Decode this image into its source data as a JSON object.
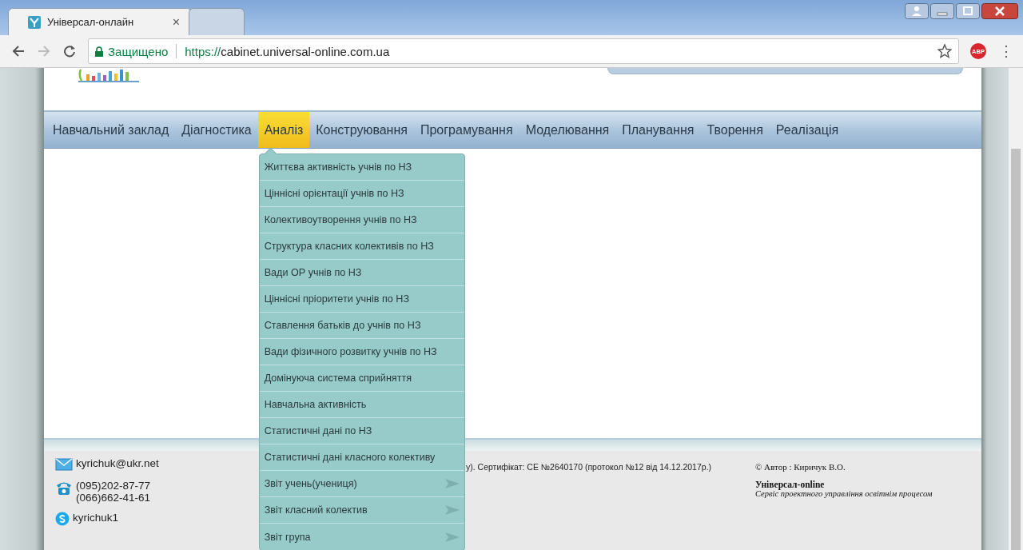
{
  "browser": {
    "tabs": [
      {
        "title": "Універсал-онлайн",
        "close": "×",
        "selected": true
      },
      {
        "selected": false
      }
    ],
    "security_label": "Защищено",
    "url_scheme": "https://",
    "url_host": "cabinet.universal-online.com.ua",
    "extension_label": "ABP",
    "menu_glyph": "⋮"
  },
  "nav": {
    "items": [
      {
        "label": "Навчальний заклад",
        "selected": false
      },
      {
        "label": "Діагностика",
        "selected": false
      },
      {
        "label": "Аналіз",
        "selected": true
      },
      {
        "label": "Конструювання",
        "selected": false
      },
      {
        "label": "Програмування",
        "selected": false
      },
      {
        "label": "Моделювання",
        "selected": false
      },
      {
        "label": "Планування",
        "selected": false
      },
      {
        "label": "Творення",
        "selected": false
      },
      {
        "label": "Реалізація",
        "selected": false
      }
    ]
  },
  "dropdown": {
    "items": [
      {
        "label": "Життєва активність учнів по НЗ",
        "kind": "item"
      },
      {
        "label": "Ціннісні орієнтації учнів по НЗ",
        "kind": "item"
      },
      {
        "label": "Колективоутворення учнів по НЗ",
        "kind": "item"
      },
      {
        "label": "Структура класних колективів по НЗ",
        "kind": "item"
      },
      {
        "label": "Вади ОР учнів по НЗ",
        "kind": "item"
      },
      {
        "label": "Ціннісні пріоритети учнів по НЗ",
        "kind": "item"
      },
      {
        "label": "Ставлення батьків до учнів по НЗ",
        "kind": "item"
      },
      {
        "label": "Вади фізичного розвитку учнів по НЗ",
        "kind": "item"
      },
      {
        "label": "Домінуюча система сприйняття",
        "kind": "item"
      },
      {
        "label": "Навчальна активність",
        "kind": "item"
      },
      {
        "label": "Статистичні дані по НЗ",
        "kind": "item"
      },
      {
        "label": "Статистичні дані класного колективу",
        "kind": "item"
      },
      {
        "label": "Звіт учень(учениця)",
        "kind": "submenu"
      },
      {
        "label": "Звіт класний колектив",
        "kind": "submenu"
      },
      {
        "label": "Звіт група",
        "kind": "submenu"
      }
    ]
  },
  "footer": {
    "email": "kyrichuk@ukr.net",
    "phones": [
      "(095)202-87-77",
      "(066)662-41-61"
    ],
    "skype": "kyrichuk1",
    "certificate": "у). Сертифікат: СЕ №2640170 (протокол №12 від 14.12.2017р.)",
    "author": "© Автор : Киричук В.О.",
    "brand": "Універсал-online",
    "tagline": "Сервіс проектного управління освітнім процесом"
  }
}
